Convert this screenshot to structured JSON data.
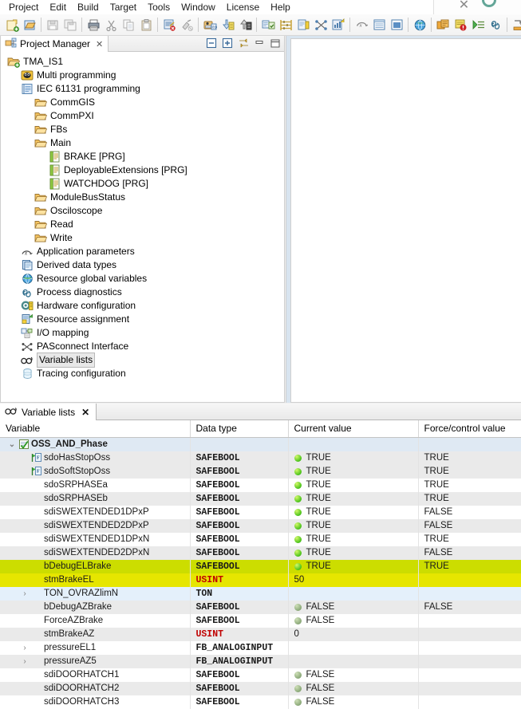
{
  "window": {
    "close_glyph": "✕",
    "circle_control": "circle-control"
  },
  "menubar": {
    "items": [
      {
        "label": "Project",
        "name": "menu-project"
      },
      {
        "label": "Edit",
        "name": "menu-edit"
      },
      {
        "label": "Build",
        "name": "menu-build"
      },
      {
        "label": "Target",
        "name": "menu-target"
      },
      {
        "label": "Tools",
        "name": "menu-tools"
      },
      {
        "label": "Window",
        "name": "menu-window"
      },
      {
        "label": "License",
        "name": "menu-license"
      },
      {
        "label": "Help",
        "name": "menu-help"
      }
    ]
  },
  "toolbar": {
    "buttons": [
      {
        "icon": "new-project-icon"
      },
      {
        "icon": "open-project-icon"
      },
      {
        "sep": true
      },
      {
        "icon": "save-icon"
      },
      {
        "icon": "save-all-icon"
      },
      {
        "sep": true
      },
      {
        "icon": "print-icon"
      },
      {
        "icon": "cut-icon"
      },
      {
        "icon": "copy-icon"
      },
      {
        "icon": "paste-icon"
      },
      {
        "sep": true
      },
      {
        "icon": "build-error-icon"
      },
      {
        "icon": "clean-icon"
      },
      {
        "sep": true
      },
      {
        "icon": "connect-target-icon"
      },
      {
        "icon": "download-icon"
      },
      {
        "icon": "upload-icon"
      },
      {
        "sep": true
      },
      {
        "icon": "compare-icon"
      },
      {
        "icon": "ladder-icon"
      },
      {
        "icon": "online-change-icon"
      },
      {
        "icon": "cross-reference-icon"
      },
      {
        "icon": "chart-icon"
      },
      {
        "sep": true
      },
      {
        "icon": "debug-icon"
      },
      {
        "icon": "variable-list-icon"
      },
      {
        "icon": "monitor-icon"
      },
      {
        "sep": true
      },
      {
        "icon": "globe-icon"
      },
      {
        "sep": true
      },
      {
        "icon": "resource-icon"
      },
      {
        "icon": "diagnostics-icon"
      },
      {
        "icon": "run-icon"
      },
      {
        "icon": "link-icon"
      },
      {
        "sep": true
      },
      {
        "icon": "export-icon"
      }
    ]
  },
  "project_manager": {
    "tab_label": "Project Manager",
    "tab_icon": "project-manager-icon",
    "tab_close": "✕",
    "tools": [
      {
        "name": "collapse-all-button",
        "icon": "collapse-all-icon"
      },
      {
        "name": "expand-all-button",
        "icon": "expand-all-icon"
      },
      {
        "name": "link-with-editor-button",
        "icon": "link-editor-icon"
      },
      {
        "name": "minimize-view-button",
        "icon": "minimize-icon"
      },
      {
        "name": "maximize-view-button",
        "icon": "maximize-icon"
      }
    ],
    "tree": [
      {
        "label": "TMA_IS1",
        "depth": 0,
        "icon": "project-root-icon",
        "selected": false
      },
      {
        "label": "Multi programming",
        "depth": 1,
        "icon": "multi-programming-icon",
        "selected": false
      },
      {
        "label": "IEC 61131 programming",
        "depth": 1,
        "icon": "iec-programming-icon",
        "selected": false
      },
      {
        "label": "CommGIS",
        "depth": 2,
        "icon": "folder-icon",
        "selected": false
      },
      {
        "label": "CommPXI",
        "depth": 2,
        "icon": "folder-icon",
        "selected": false
      },
      {
        "label": "FBs",
        "depth": 2,
        "icon": "folder-icon",
        "selected": false
      },
      {
        "label": "Main",
        "depth": 2,
        "icon": "folder-icon",
        "selected": false
      },
      {
        "label": "BRAKE [PRG]",
        "depth": 3,
        "icon": "program-icon",
        "selected": false
      },
      {
        "label": "DeployableExtensions [PRG]",
        "depth": 3,
        "icon": "program-icon",
        "selected": false
      },
      {
        "label": "WATCHDOG [PRG]",
        "depth": 3,
        "icon": "program-icon",
        "selected": false
      },
      {
        "label": "ModuleBusStatus",
        "depth": 2,
        "icon": "folder-icon",
        "selected": false
      },
      {
        "label": "Osciloscope",
        "depth": 2,
        "icon": "folder-icon",
        "selected": false
      },
      {
        "label": "Read",
        "depth": 2,
        "icon": "folder-icon",
        "selected": false
      },
      {
        "label": "Write",
        "depth": 2,
        "icon": "folder-icon",
        "selected": false
      },
      {
        "label": "Application parameters",
        "depth": 1,
        "icon": "application-parameters-icon",
        "selected": false
      },
      {
        "label": "Derived data types",
        "depth": 1,
        "icon": "derived-data-types-icon",
        "selected": false
      },
      {
        "label": "Resource global variables",
        "depth": 1,
        "icon": "globe-icon",
        "selected": false
      },
      {
        "label": "Process diagnostics",
        "depth": 1,
        "icon": "process-diagnostics-icon",
        "selected": false
      },
      {
        "label": "Hardware configuration",
        "depth": 1,
        "icon": "hardware-configuration-icon",
        "selected": false
      },
      {
        "label": "Resource assignment",
        "depth": 1,
        "icon": "resource-assignment-icon",
        "selected": false
      },
      {
        "label": "I/O mapping",
        "depth": 1,
        "icon": "io-mapping-icon",
        "selected": false
      },
      {
        "label": "PASconnect Interface",
        "depth": 1,
        "icon": "pasconnect-icon",
        "selected": false
      },
      {
        "label": "Variable lists",
        "depth": 1,
        "icon": "variable-lists-icon",
        "selected": true
      },
      {
        "label": "Tracing configuration",
        "depth": 1,
        "icon": "tracing-configuration-icon",
        "selected": false
      }
    ]
  },
  "variable_lists": {
    "tab_label": "Variable lists",
    "tab_icon": "variable-lists-icon",
    "tab_close": "✕",
    "columns": [
      {
        "label": "Variable"
      },
      {
        "label": "Data type"
      },
      {
        "label": "Current value"
      },
      {
        "label": "Force/control value"
      }
    ],
    "rows": [
      {
        "variable": "OSS_AND_Phase",
        "datatype": "",
        "current": "",
        "force": "",
        "kind": "group",
        "twisty": "⌄",
        "icon": "checked-list-icon"
      },
      {
        "variable": "sdoHasStopOss",
        "datatype": "SAFEBOOL",
        "current": "TRUE",
        "force": "TRUE",
        "kind": "alt",
        "led": "on",
        "icon": "force-flag-icon"
      },
      {
        "variable": "sdoSoftStopOss",
        "datatype": "SAFEBOOL",
        "current": "TRUE",
        "force": "TRUE",
        "kind": "alt",
        "led": "on",
        "icon": "force-flag-icon"
      },
      {
        "variable": "sdoSRPHASEa",
        "datatype": "SAFEBOOL",
        "current": "TRUE",
        "force": "TRUE",
        "kind": "row",
        "led": "on"
      },
      {
        "variable": "sdoSRPHASEb",
        "datatype": "SAFEBOOL",
        "current": "TRUE",
        "force": "TRUE",
        "kind": "alt",
        "led": "on"
      },
      {
        "variable": "sdiSWEXTENDED1DPxP",
        "datatype": "SAFEBOOL",
        "current": "TRUE",
        "force": "FALSE",
        "kind": "row",
        "led": "on"
      },
      {
        "variable": "sdiSWEXTENDED2DPxP",
        "datatype": "SAFEBOOL",
        "current": "TRUE",
        "force": "FALSE",
        "kind": "alt",
        "led": "on"
      },
      {
        "variable": "sdiSWEXTENDED1DPxN",
        "datatype": "SAFEBOOL",
        "current": "TRUE",
        "force": "TRUE",
        "kind": "row",
        "led": "on"
      },
      {
        "variable": "sdiSWEXTENDED2DPxN",
        "datatype": "SAFEBOOL",
        "current": "TRUE",
        "force": "FALSE",
        "kind": "alt",
        "led": "on"
      },
      {
        "variable": "bDebugELBrake",
        "datatype": "SAFEBOOL",
        "current": "TRUE",
        "force": "TRUE",
        "kind": "hl-a",
        "led": "on"
      },
      {
        "variable": "stmBrakeEL",
        "datatype": "USINT",
        "current": "50",
        "force": "",
        "kind": "hl-b",
        "led": "none",
        "type_color": "red"
      },
      {
        "variable": "TON_OVRAZlimN",
        "datatype": "TON",
        "current": "",
        "force": "",
        "kind": "selrow",
        "twisty": "›",
        "led": "none"
      },
      {
        "variable": "bDebugAZBrake",
        "datatype": "SAFEBOOL",
        "current": "FALSE",
        "force": "FALSE",
        "kind": "alt",
        "led": "off"
      },
      {
        "variable": "ForceAZBrake",
        "datatype": "SAFEBOOL",
        "current": "FALSE",
        "force": "",
        "kind": "row",
        "led": "off"
      },
      {
        "variable": "stmBrakeAZ",
        "datatype": "USINT",
        "current": "0",
        "force": "",
        "kind": "alt",
        "led": "none",
        "type_color": "red"
      },
      {
        "variable": "pressureEL1",
        "datatype": "FB_ANALOGINPUT",
        "current": "",
        "force": "",
        "kind": "row",
        "twisty": "›",
        "led": "none"
      },
      {
        "variable": "pressureAZ5",
        "datatype": "FB_ANALOGINPUT",
        "current": "",
        "force": "",
        "kind": "alt",
        "twisty": "›",
        "led": "none"
      },
      {
        "variable": "sdiDOORHATCH1",
        "datatype": "SAFEBOOL",
        "current": "FALSE",
        "force": "",
        "kind": "row",
        "led": "off"
      },
      {
        "variable": "sdiDOORHATCH2",
        "datatype": "SAFEBOOL",
        "current": "FALSE",
        "force": "",
        "kind": "alt",
        "led": "off"
      },
      {
        "variable": "sdiDOORHATCH3",
        "datatype": "SAFEBOOL",
        "current": "FALSE",
        "force": "",
        "kind": "row",
        "led": "off"
      }
    ]
  },
  "colors": {
    "highlight_primary": "#ccdd00",
    "highlight_secondary": "#e6e600",
    "selection_blue": "#e4f0fb",
    "group_row": "#dfe9f3",
    "datatype_text": "#a0186b",
    "usint_text": "#c00000",
    "led_true": "#49c21a",
    "led_false": "#8aa878"
  }
}
